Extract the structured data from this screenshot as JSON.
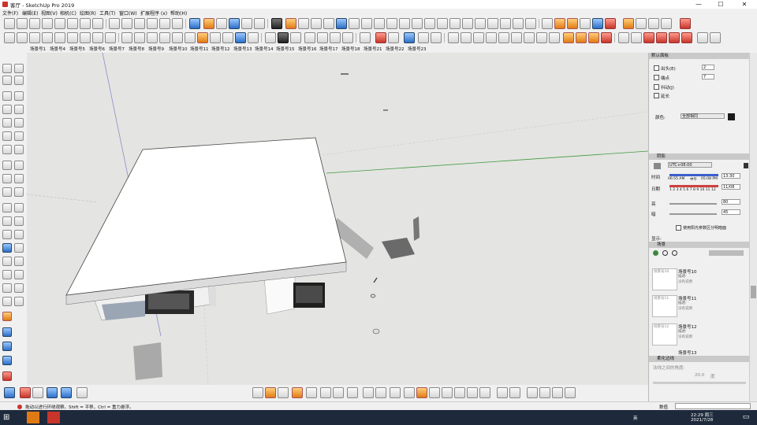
{
  "window": {
    "title": "客厅 - SketchUp Pro 2019",
    "minimize": "—",
    "maximize": "☐",
    "close": "✕"
  },
  "menu": [
    "文件(F)",
    "编辑(E)",
    "视图(V)",
    "相机(C)",
    "绘图(R)",
    "工具(T)",
    "窗口(W)",
    "扩展程序 (x)",
    "帮助(H)"
  ],
  "scenes": [
    "场景号1",
    "场景号4",
    "场景号5",
    "场景号6",
    "场景号7",
    "场景号8",
    "场景号9",
    "场景号10",
    "场景号11",
    "场景号12",
    "场景号13",
    "场景号14",
    "场景号15",
    "场景号16",
    "场景号17",
    "场景号18",
    "场景号21",
    "场景号22",
    "场景号23"
  ],
  "panel": {
    "header": "默认面板",
    "outline": {
      "rows": [
        {
          "label": "出头(E)",
          "value": "2"
        },
        {
          "label": "端点",
          "value": "7"
        },
        {
          "label": "抖动(J)",
          "value": ""
        },
        {
          "label": "延长",
          "value": ""
        }
      ],
      "color_label": "颜色:",
      "color_value": "全部相同"
    },
    "shadow": {
      "title": "阴影",
      "tz": "UTC+08:00",
      "time_label": "时间",
      "time_start": "06:55 AM",
      "time_mid": "中午",
      "time_end": "05:08 PM",
      "time_value": "13:30",
      "date_label": "日期",
      "months": "1 2 3 4 5 6 7 8 9 10 11 12",
      "date_value": "11/08",
      "light_label": "亮",
      "light_value": "80",
      "dark_label": "暗",
      "dark_value": "45",
      "sun_checkbox": "使用阳光参数区分明暗面",
      "show_label": "显示:"
    },
    "scenes": {
      "title": "场景",
      "items": [
        {
          "thumb": "场景号10",
          "name": "场景号10",
          "desc_label": "描述:",
          "desc": "没有说明"
        },
        {
          "thumb": "场景号11",
          "name": "场景号11",
          "desc_label": "描述:",
          "desc": "没有说明"
        },
        {
          "thumb": "场景号12",
          "name": "场景号12",
          "desc_label": "描述:",
          "desc": "没有说明"
        },
        {
          "thumb": "",
          "name": "场景号13",
          "desc_label": "",
          "desc": ""
        }
      ]
    },
    "soften": {
      "title": "柔化边线",
      "normal_label": "法线之间的角度:",
      "normal_value": "20.0",
      "degree_label": "度"
    }
  },
  "status": {
    "text": "拖动以进行环绕观察。Shift = 平移，Ctrl = 重力悬浮。",
    "measure_label": "数值"
  },
  "taskbar": {
    "time": "22:29 周三",
    "date": "2021/7/28",
    "lang": "英"
  }
}
